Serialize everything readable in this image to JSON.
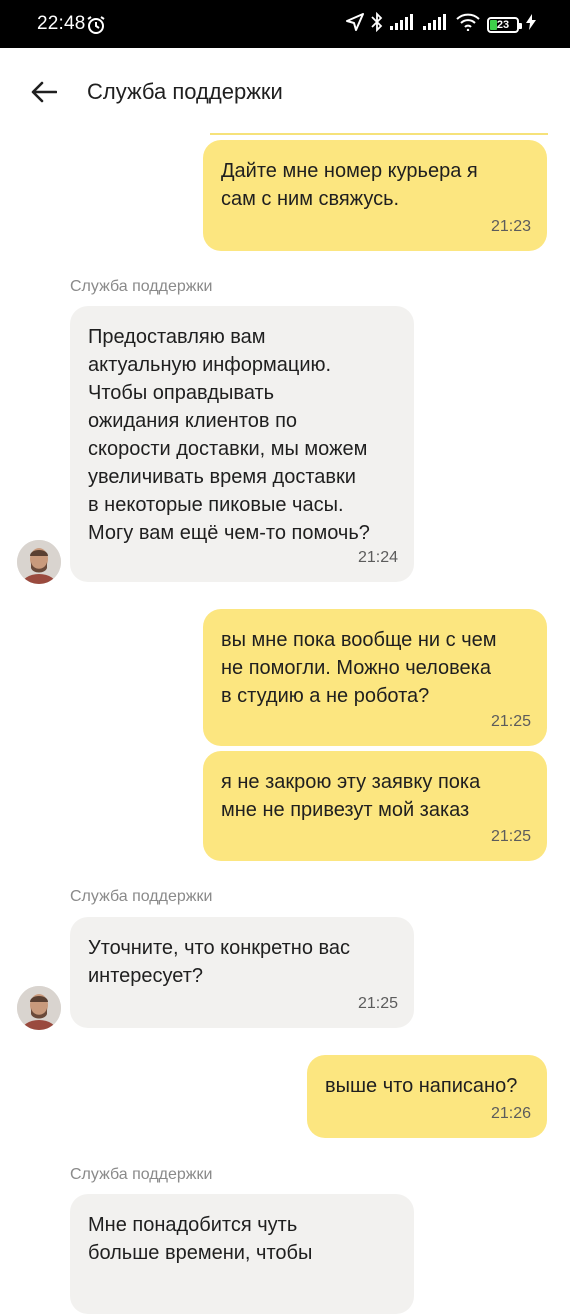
{
  "status_bar": {
    "time": "22:48",
    "battery_level": "23"
  },
  "header": {
    "title": "Служба поддержки"
  },
  "messages": [
    {
      "from": "user",
      "text": "Дайте мне номер курьера я\nсам с ним свяжусь.",
      "time": "21:23"
    },
    {
      "from": "support",
      "sender": "Служба поддержки",
      "text": "Предоставляю вам\nактуальную информацию.\nЧтобы оправдывать\nожидания клиентов по\nскорости доставки, мы можем\nувеличивать время доставки\nв некоторые пиковые часы.\nМогу вам ещё чем-то помочь?",
      "time": "21:24"
    },
    {
      "from": "user",
      "text": "вы мне пока вообще ни с чем\nне помогли. Можно человека\nв студию а не робота?",
      "time": "21:25"
    },
    {
      "from": "user",
      "text": "я не закрою эту заявку пока\nмне не привезут мой заказ",
      "time": "21:25"
    },
    {
      "from": "support",
      "sender": "Служба поддержки",
      "text": "Уточните, что конкретно вас\nинтересует?",
      "time": "21:25"
    },
    {
      "from": "user",
      "text": "выше что написано?",
      "time": "21:26"
    },
    {
      "from": "support",
      "sender": "Служба поддержки",
      "text": "Мне понадобится чуть\nбольше времени, чтобы",
      "time": ""
    }
  ],
  "colors": {
    "user_bubble": "#fce680",
    "support_bubble": "#f2f1ef",
    "status_bar": "#000000"
  }
}
